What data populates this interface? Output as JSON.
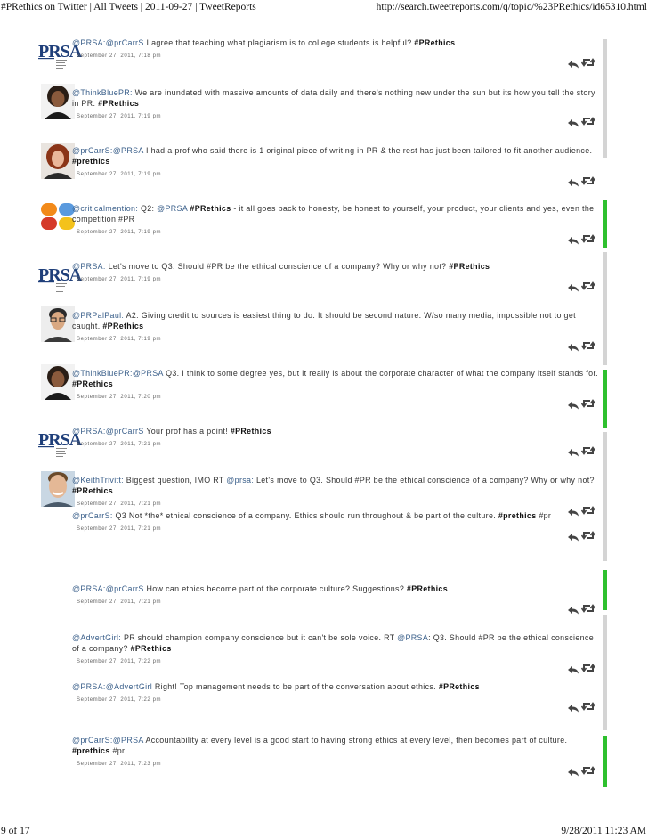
{
  "print_header": {
    "title": "#PRethics on Twitter | All Tweets | 2011-09-27 | TweetReports",
    "url": "http://search.tweetreports.com/q/topic/%23PRethics/id65310.html"
  },
  "print_footer": {
    "page": "9 of 17",
    "datetime": "9/28/2011 11:23 AM"
  },
  "tweets": [
    {
      "user": "@PRSA:",
      "avatar": "prsa-logo",
      "parts": [
        {
          "t": "m",
          "v": "@prCarrS"
        },
        {
          "t": "p",
          "v": " I agree that teaching what plagiarism is to college students is helpful? "
        },
        {
          "t": "h",
          "v": "#PRethics"
        }
      ],
      "time": "September 27, 2011, 7:18 pm"
    },
    {
      "user": "@ThinkBluePR:",
      "avatar": "woman-dark-hair",
      "parts": [
        {
          "t": "p",
          "v": " We are inundated with massive amounts of data daily and there's nothing new under the sun but its how you tell the story in PR. "
        },
        {
          "t": "h",
          "v": "#PRethics"
        }
      ],
      "time": "September 27, 2011, 7:19 pm"
    },
    {
      "user": "@prCarrS:",
      "avatar": "woman-red-hair",
      "parts": [
        {
          "t": "m",
          "v": "@PRSA"
        },
        {
          "t": "p",
          "v": " I had a prof who said there is 1 original piece of writing in PR & the rest has just been tailored to fit another audience. "
        },
        {
          "t": "h",
          "v": "#prethics"
        }
      ],
      "time": "September 27, 2011, 7:19 pm"
    },
    {
      "user": "@criticalmention:",
      "avatar": "colored-squares-logo",
      "parts": [
        {
          "t": "p",
          "v": " Q2: "
        },
        {
          "t": "m",
          "v": "@PRSA"
        },
        {
          "t": "p",
          "v": " "
        },
        {
          "t": "h",
          "v": "#PRethics"
        },
        {
          "t": "p",
          "v": " - it all goes back to honesty, be honest to yourself, your product, your clients and yes, even the competition #PR"
        }
      ],
      "time": "September 27, 2011, 7:19 pm"
    },
    {
      "user": "@PRSA:",
      "avatar": "prsa-logo",
      "parts": [
        {
          "t": "p",
          "v": " Let's move to Q3. Should #PR be the ethical conscience of a company? Why or why not? "
        },
        {
          "t": "h",
          "v": "#PRethics"
        }
      ],
      "time": "September 27, 2011, 7:19 pm"
    },
    {
      "user": "@PRPalPaul:",
      "avatar": "man-glasses",
      "parts": [
        {
          "t": "p",
          "v": " A2: Giving credit to sources is easiest thing to do. It should be second nature. W/so many media, impossible not to get caught. "
        },
        {
          "t": "h",
          "v": "#PRethics"
        }
      ],
      "time": "September 27, 2011, 7:19 pm"
    },
    {
      "user": "@ThinkBluePR:",
      "avatar": "woman-dark-hair",
      "parts": [
        {
          "t": "m",
          "v": "@PRSA"
        },
        {
          "t": "p",
          "v": " Q3. I think to some degree yes, but it really is about the corporate character of what the company itself stands for. "
        },
        {
          "t": "h",
          "v": "#PRethics"
        }
      ],
      "time": "September 27, 2011, 7:20 pm"
    },
    {
      "user": "@PRSA:",
      "avatar": "prsa-logo",
      "parts": [
        {
          "t": "m",
          "v": "@prCarrS"
        },
        {
          "t": "p",
          "v": " Your prof has a point! "
        },
        {
          "t": "h",
          "v": "#PRethics"
        }
      ],
      "time": "September 27, 2011, 7:21 pm"
    },
    {
      "user": "@KeithTrivitt:",
      "avatar": "man-smiling",
      "parts": [
        {
          "t": "p",
          "v": " Biggest question, IMO RT "
        },
        {
          "t": "m",
          "v": "@prsa:"
        },
        {
          "t": "p",
          "v": " Let's move to Q3. Should #PR be the ethical conscience of a company? Why or why not? "
        },
        {
          "t": "h",
          "v": "#PRethics"
        }
      ],
      "time": "September 27, 2011, 7:21 pm"
    },
    {
      "user": "@prCarrS:",
      "avatar": "",
      "parts": [
        {
          "t": "p",
          "v": " Q3 Not *the* ethical conscience of a company. Ethics should run throughout & be part of the culture. "
        },
        {
          "t": "h",
          "v": "#prethics"
        },
        {
          "t": "p",
          "v": " #pr"
        }
      ],
      "time": "September 27, 2011, 7:21 pm"
    },
    {
      "user": "@PRSA:",
      "avatar": "",
      "parts": [
        {
          "t": "m",
          "v": "@prCarrS"
        },
        {
          "t": "p",
          "v": " How can ethics become part of the corporate culture? Suggestions? "
        },
        {
          "t": "h",
          "v": "#PRethics"
        }
      ],
      "time": "September 27, 2011, 7:21 pm"
    },
    {
      "user": "@AdvertGirl:",
      "avatar": "",
      "parts": [
        {
          "t": "p",
          "v": " PR should champion company conscience but it can't be sole voice. RT "
        },
        {
          "t": "m",
          "v": "@PRSA"
        },
        {
          "t": "p",
          "v": ": Q3. Should #PR be the ethical conscience of a company? "
        },
        {
          "t": "h",
          "v": "#PRethics"
        }
      ],
      "time": "September 27, 2011, 7:22 pm"
    },
    {
      "user": "@PRSA:",
      "avatar": "",
      "parts": [
        {
          "t": "m",
          "v": "@AdvertGirl"
        },
        {
          "t": "p",
          "v": " Right! Top management needs to be part of the conversation about ethics. "
        },
        {
          "t": "h",
          "v": "#PRethics"
        }
      ],
      "time": "September 27, 2011, 7:22 pm"
    },
    {
      "user": "@prCarrS:",
      "avatar": "",
      "parts": [
        {
          "t": "m",
          "v": "@PRSA"
        },
        {
          "t": "p",
          "v": " Accountability at every level is a good start to having strong ethics at every level, then becomes part of culture. "
        },
        {
          "t": "h",
          "v": "#prethics"
        },
        {
          "t": "p",
          "v": " #pr"
        }
      ],
      "time": "September 27, 2011, 7:23 pm"
    }
  ],
  "colors": {
    "username": "#3a5f8a",
    "timestamp": "#666666",
    "bar_gray": "#d4d4d4",
    "bar_green": "#2ec02e",
    "prsa_blue": "#1f3f7a"
  }
}
